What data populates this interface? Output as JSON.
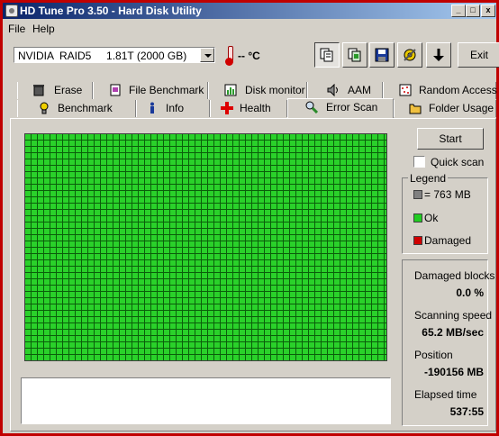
{
  "window": {
    "title": "HD Tune Pro 3.50 - Hard Disk Utility",
    "min": "_",
    "max": "□",
    "close": "x"
  },
  "menu": {
    "file": "File",
    "help": "Help"
  },
  "toolbar": {
    "drive": "NVIDIA  RAID5     1.81T (2000 GB)",
    "temperature": "-- °C",
    "exit": "Exit",
    "icons": [
      "copy-text-icon",
      "copy-screenshot-icon",
      "save-icon",
      "options-icon",
      "download-icon"
    ]
  },
  "tabs": {
    "row1": [
      {
        "label": "Erase",
        "icon": "trash-icon"
      },
      {
        "label": "File Benchmark",
        "icon": "file-icon"
      },
      {
        "label": "Disk monitor",
        "icon": "monitor-icon"
      },
      {
        "label": "AAM",
        "icon": "speaker-icon"
      },
      {
        "label": "Random Access",
        "icon": "random-access-icon"
      }
    ],
    "row2": [
      {
        "label": "Benchmark",
        "icon": "bulb-icon"
      },
      {
        "label": "Info",
        "icon": "info-icon"
      },
      {
        "label": "Health",
        "icon": "health-cross-icon"
      },
      {
        "label": "Error Scan",
        "icon": "magnifier-icon",
        "active": true
      },
      {
        "label": "Folder Usage",
        "icon": "folder-icon"
      }
    ]
  },
  "scan": {
    "start": "Start",
    "quick_scan": "Quick scan",
    "quick_scan_checked": false,
    "legend_title": "Legend",
    "legend": [
      {
        "label": "= 763 MB",
        "color": "#808080"
      },
      {
        "label": "Ok",
        "color": "#22cc22"
      },
      {
        "label": "Damaged",
        "color": "#d00000"
      }
    ],
    "stats": {
      "damaged_label": "Damaged blocks",
      "damaged_value": "0.0 %",
      "speed_label": "Scanning speed",
      "speed_value": "65.2 MB/sec",
      "position_label": "Position",
      "position_value": "-190156 MB",
      "elapsed_label": "Elapsed time",
      "elapsed_value": "537:55"
    },
    "block_state": "all-ok",
    "log": ""
  },
  "colors": {
    "titlebar": "#0a246a",
    "ok": "#22cc22",
    "damaged": "#d00000",
    "border": "#c00000"
  }
}
